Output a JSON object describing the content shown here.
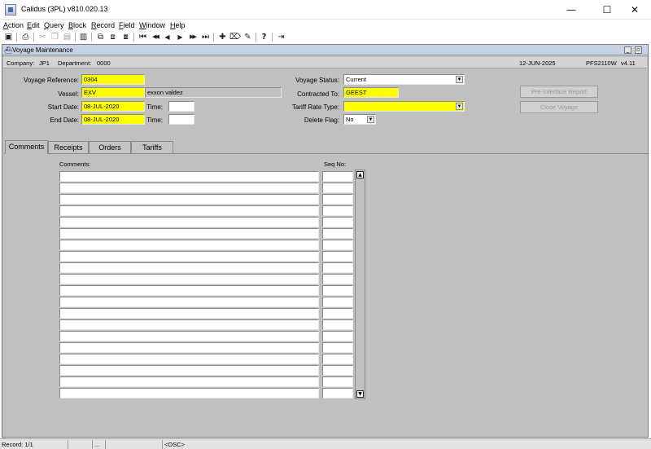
{
  "window": {
    "title": "Calidus (3PL) v810.020.13",
    "min_glyph": "—",
    "max_glyph": "☐",
    "close_glyph": "✕"
  },
  "menu": [
    {
      "label": "Action",
      "accel": "A",
      "rest": "ction"
    },
    {
      "label": "Edit",
      "accel": "E",
      "rest": "dit"
    },
    {
      "label": "Query",
      "accel": "Q",
      "rest": "uery"
    },
    {
      "label": "Block",
      "accel": "B",
      "rest": "lock"
    },
    {
      "label": "Record",
      "accel": "R",
      "rest": "ecord"
    },
    {
      "label": "Field",
      "accel": "F",
      "rest": "ield"
    },
    {
      "label": "Window",
      "accel": "W",
      "rest": "indow"
    },
    {
      "label": "Help",
      "accel": "H",
      "rest": "elp"
    }
  ],
  "toolbar": {
    "icons": [
      {
        "name": "save-icon",
        "glyph": "▣",
        "enabled": true
      },
      {
        "name": "print-icon",
        "glyph": "⎙",
        "enabled": true
      },
      {
        "name": "cut-icon",
        "glyph": "✂",
        "enabled": false
      },
      {
        "name": "copy-icon",
        "glyph": "❐",
        "enabled": false
      },
      {
        "name": "paste-icon",
        "glyph": "▤",
        "enabled": false
      },
      {
        "name": "list-of-values-icon",
        "glyph": "▥",
        "enabled": true
      },
      {
        "name": "enter-query-icon",
        "glyph": "⧉",
        "enabled": true
      },
      {
        "name": "execute-query-icon",
        "glyph": "⧈",
        "enabled": true
      },
      {
        "name": "cancel-query-icon",
        "glyph": "⧇",
        "enabled": true
      },
      {
        "name": "first-record-icon",
        "glyph": "⏮",
        "enabled": true
      },
      {
        "name": "previous-block-icon",
        "glyph": "◀◀",
        "enabled": true
      },
      {
        "name": "previous-record-icon",
        "glyph": "◀",
        "enabled": true
      },
      {
        "name": "next-record-icon",
        "glyph": "▶",
        "enabled": true
      },
      {
        "name": "next-block-icon",
        "glyph": "▶▶",
        "enabled": true
      },
      {
        "name": "last-record-icon",
        "glyph": "⏭",
        "enabled": true
      },
      {
        "name": "insert-record-icon",
        "glyph": "✚",
        "enabled": true
      },
      {
        "name": "delete-record-icon",
        "glyph": "⌦",
        "enabled": true
      },
      {
        "name": "clear-record-icon",
        "glyph": "✎",
        "enabled": true
      },
      {
        "name": "help-icon",
        "glyph": "?",
        "enabled": true
      },
      {
        "name": "exit-icon",
        "glyph": "⇥",
        "enabled": true
      }
    ]
  },
  "form": {
    "title": "Voyage Maintenance",
    "company_label": "Company:",
    "company_value": "JP1",
    "department_label": "Department:",
    "department_value": "0000",
    "date": "12-JUN-2025",
    "form_code": "PFS2110W",
    "version": "v4.11"
  },
  "fields": {
    "voyage_reference": {
      "label": "Voyage Reference:",
      "value": "0304"
    },
    "vessel": {
      "label": "Vessel:",
      "code": "EXV",
      "name": "exxon valdez"
    },
    "start_date": {
      "label": "Start Date:",
      "value": "08-JUL-2020",
      "time_label": "Time:",
      "time_value": ""
    },
    "end_date": {
      "label": "End Date:",
      "value": "08-JUL-2020",
      "time_label": "Time:",
      "time_value": ""
    },
    "voyage_status": {
      "label": "Voyage Status:",
      "value": "Current"
    },
    "contracted_to": {
      "label": "Contracted To:",
      "value": "GEEST"
    },
    "tariff_rate_type": {
      "label": "Tariff Rate Type:",
      "value": ""
    },
    "delete_flag": {
      "label": "Delete Flag:",
      "value": "No"
    }
  },
  "buttons": {
    "pre_interface_report": "Pre-Interface Report",
    "close_voyage": "Close Voyage"
  },
  "tabs": [
    {
      "label": "Comments",
      "active": true
    },
    {
      "label": "Receipts",
      "active": false
    },
    {
      "label": "Orders",
      "active": false
    },
    {
      "label": "Tariffs",
      "active": false
    }
  ],
  "comments_table": {
    "headers": {
      "comments": "Comments:",
      "seq_no": "Seq No:"
    },
    "row_count": 20,
    "rows": []
  },
  "statusbar": {
    "record": "Record: 1/1",
    "segment2": "",
    "segment3": "...",
    "segment4": "",
    "osc": "<OSC>"
  }
}
